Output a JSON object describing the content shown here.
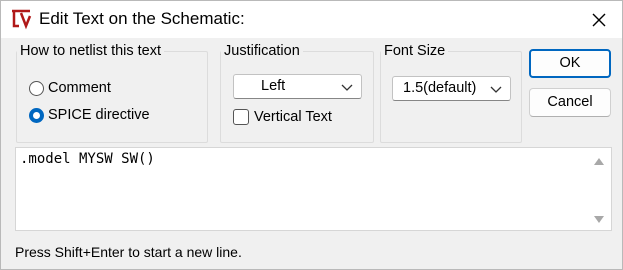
{
  "window": {
    "title": "Edit Text on the Schematic:",
    "icons": {
      "app": "ltspice-app-icon",
      "close": "close-icon"
    }
  },
  "netlist_group": {
    "legend": "How to netlist this text",
    "options": [
      {
        "label": "Comment",
        "selected": false
      },
      {
        "label": "SPICE directive",
        "selected": true
      }
    ]
  },
  "justification_group": {
    "legend": "Justification",
    "selected": "Left",
    "vertical_text_label": "Vertical Text",
    "vertical_text_checked": false
  },
  "font_size_group": {
    "legend": "Font Size",
    "selected": "1.5(default)"
  },
  "buttons": {
    "ok": "OK",
    "cancel": "Cancel"
  },
  "editor": {
    "text": ".model MYSW SW()"
  },
  "status_text": "Press Shift+Enter to start a new line.",
  "colors": {
    "accent": "#0067c0",
    "background": "#f0f0f0",
    "icon_red": "#b01818"
  }
}
